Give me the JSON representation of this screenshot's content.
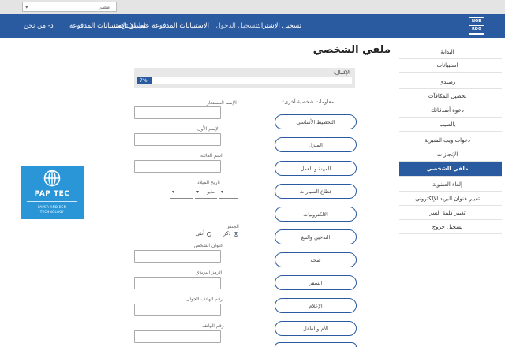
{
  "topbar": {
    "country_value": "مصر"
  },
  "nav": {
    "logo_text": [
      "NOB",
      "RDG"
    ],
    "items": [
      {
        "label": "تسجيل الإشتراك"
      },
      {
        "label": "تسجيل الدخول"
      },
      {
        "label": "الاستبيانات المدفوعة على الانترنت"
      },
      {
        "label": "تطبيق الاستبيانات المدفوعة"
      },
      {
        "label": "د- من نحن"
      }
    ]
  },
  "sidebar": {
    "items": [
      {
        "label": "البداية"
      },
      {
        "label": "استبيانات"
      },
      {
        "label": "رصيدي"
      },
      {
        "label": "تحصيل المكافآت"
      },
      {
        "label": "دعوة أصدقائك"
      },
      {
        "label": "بالصيب"
      },
      {
        "label": "دعوات ويب الشبرية"
      },
      {
        "label": "الإنجازات"
      },
      {
        "label": "ملفي الشخصي"
      },
      {
        "label": "إلغاء العضوية"
      },
      {
        "label": "تغيير عنوان البريد الإلكتروني"
      },
      {
        "label": "تغيير كلمة السر"
      },
      {
        "label": "تسجيل خروج"
      }
    ]
  },
  "page": {
    "title": "ملفي الشخصي"
  },
  "progress": {
    "label": "الإكمال:",
    "value_text": "7%",
    "fraction": 0.07
  },
  "form": {
    "username_label": "الإسم المستعار",
    "first_name_label": "الإسم الأول",
    "family_name_label": "اسم العائلة",
    "birthdate_label": "تاريخ الميلاد",
    "birth_month": "مايو",
    "gender_label": "الجنس",
    "gender_male": "ذكر",
    "gender_female": "أنثى",
    "address_label": "عنوان الشخص",
    "postal_label": "الرمز البريدي",
    "mobile_label": "رقم الهاتف الجوال",
    "phone_label": "رقم الهاتف"
  },
  "more_info": {
    "heading": "معلومات شخصية أخرى:",
    "buttons": [
      {
        "label": "التخطيط الأساسي"
      },
      {
        "label": "المنزل"
      },
      {
        "label": "المهنة و العمل"
      },
      {
        "label": "قطاع السيارات"
      },
      {
        "label": "الالكترونيات"
      },
      {
        "label": "التدخين والتبغ"
      },
      {
        "label": "صحة"
      },
      {
        "label": "السفر"
      },
      {
        "label": "الإعلام"
      },
      {
        "label": "الأم والطفل"
      }
    ]
  },
  "badge": {
    "name": "PAP TEC",
    "sub1": "PAPER AND BEN",
    "sub2": "TECHNOLOGY"
  },
  "colors": {
    "nav": "#2a5aa0",
    "badge": "#2a96d8"
  }
}
